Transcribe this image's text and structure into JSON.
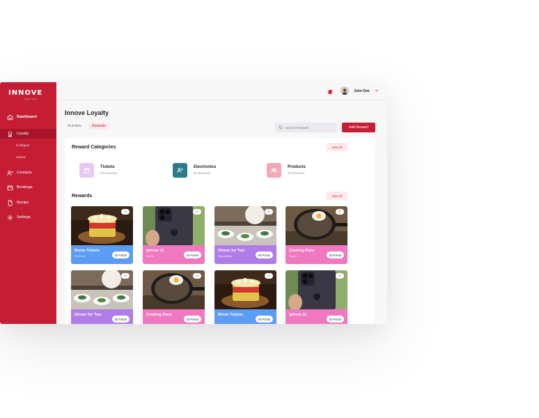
{
  "brand": {
    "logo": "INNOVE",
    "logo_sub": "loyalty suite"
  },
  "sidebar": {
    "items": [
      {
        "label": "Dashboard",
        "icon": "home-icon"
      },
      {
        "label": "Loyalty",
        "icon": "award-icon"
      },
      {
        "label": "Configure",
        "icon": ""
      },
      {
        "label": "Claims",
        "icon": ""
      },
      {
        "label": "Contacts",
        "icon": "contacts-icon"
      },
      {
        "label": "Bookings",
        "icon": "calendar-icon"
      },
      {
        "label": "Recipe",
        "icon": "file-icon"
      },
      {
        "label": "Settings",
        "icon": "gear-icon"
      }
    ]
  },
  "header": {
    "user_name": "John Doe"
  },
  "page": {
    "title": "Innove Loyalty",
    "tabs": [
      "Activities",
      "Rewards"
    ],
    "active_tab": "Rewards",
    "search_placeholder": "Search Rewards",
    "add_button": "Add Reward"
  },
  "categories": {
    "title": "Reward Categories",
    "see_all": "See All",
    "items": [
      {
        "name": "Tickets",
        "count": "20 Rewards",
        "icon": "calendar-icon",
        "color": "#e8c8ef"
      },
      {
        "name": "Electronics",
        "count": "50 Rewards",
        "icon": "user-plus-icon",
        "color": "#2c7a8a"
      },
      {
        "name": "Products",
        "count": "80 Rewards",
        "icon": "users-icon",
        "color": "#f2a9b3"
      }
    ]
  },
  "rewards": {
    "title": "Rewards",
    "see_all": "See All",
    "items": [
      {
        "title": "Movie Tickets",
        "sub": "Preferred",
        "points": "20 Points",
        "badge": "22",
        "color": "#5b9cf5",
        "photo": "popcorn"
      },
      {
        "title": "Iphone 11",
        "sub": "Secret",
        "points": "20 Points",
        "badge": "22",
        "color": "#f078c0",
        "photo": "phone"
      },
      {
        "title": "Dinner for Two",
        "sub": "Reservation",
        "points": "20 Points",
        "badge": "22",
        "color": "#b07ce8",
        "photo": "dinner"
      },
      {
        "title": "Cooking Pans",
        "sub": "Secret",
        "points": "20 Points",
        "badge": "22",
        "color": "#f078c0",
        "photo": "pan"
      },
      {
        "title": "Dinner for Two",
        "sub": "",
        "points": "20 Points",
        "badge": "22",
        "color": "#b07ce8",
        "photo": "dinner"
      },
      {
        "title": "Cooking Pans",
        "sub": "",
        "points": "20 Points",
        "badge": "22",
        "color": "#f078c0",
        "photo": "pan"
      },
      {
        "title": "Movie Tickets",
        "sub": "",
        "points": "20 Points",
        "badge": "22",
        "color": "#5b9cf5",
        "photo": "popcorn"
      },
      {
        "title": "Iphone 11",
        "sub": "",
        "points": "20 Points",
        "badge": "22",
        "color": "#f078c0",
        "photo": "phone"
      }
    ]
  },
  "colors": {
    "brand": "#c51d34",
    "brand_dark": "#a8152a",
    "tab_active_bg": "#fde8ea"
  }
}
